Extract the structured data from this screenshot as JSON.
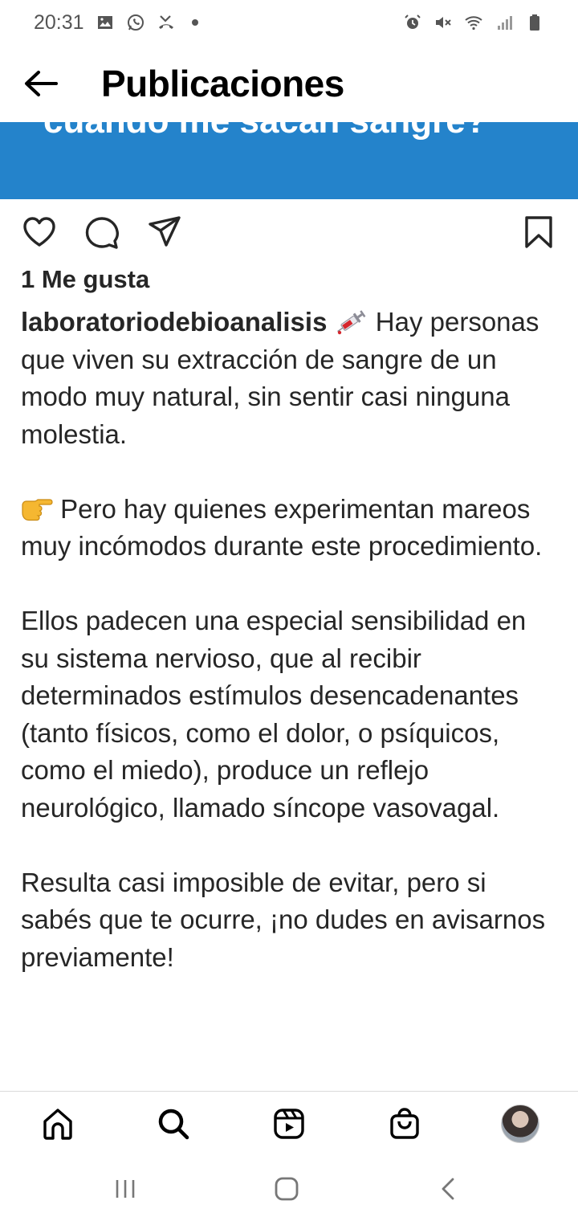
{
  "status_bar": {
    "time": "20:31",
    "left_icons": [
      "image-icon",
      "whatsapp-icon",
      "missed-call-icon",
      "notification-dot"
    ],
    "right_icons": [
      "alarm-icon",
      "mute-icon",
      "wifi-icon",
      "signal-icon",
      "battery-icon"
    ]
  },
  "header": {
    "title": "Publicaciones",
    "back_icon": "back-arrow-icon"
  },
  "media": {
    "background_color": "#2483cb",
    "visible_text": "cuando me sacan sangre?"
  },
  "actions": {
    "icons": [
      "heart-icon",
      "comment-icon",
      "share-icon",
      "bookmark-icon"
    ]
  },
  "likes": "1 Me gusta",
  "caption": {
    "username": "laboratoriodebioanalisis",
    "first_emoji": "syringe-icon",
    "p1": "Hay personas que viven su extracción de sangre de un modo muy natural, sin sentir casi ninguna molestia.",
    "second_emoji": "pointing-right-icon",
    "p2": "Pero hay quienes experimentan mareos muy incómodos durante este procedimiento.",
    "p3": "Ellos padecen una especial sensibilidad en su sistema nervioso, que al recibir determinados estímulos desencadenantes (tanto físicos, como el dolor, o psíquicos, como el miedo), produce un reflejo neurológico, llamado síncope vasovagal.",
    "p4": "Resulta casi imposible de evitar, pero si sabés que te ocurre, ¡no dudes en avisarnos previamente!"
  },
  "bottom_nav": {
    "items": [
      "home-icon",
      "search-icon",
      "reels-icon",
      "shop-icon",
      "profile-avatar"
    ]
  },
  "system_nav": {
    "items": [
      "recents-icon",
      "home-icon",
      "back-icon"
    ]
  }
}
